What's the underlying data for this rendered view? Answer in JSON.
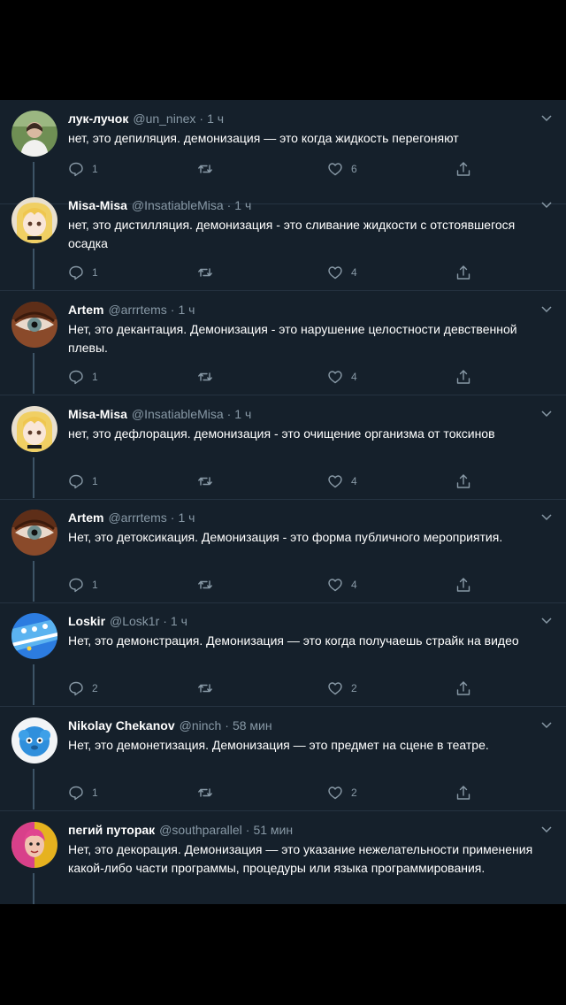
{
  "tweets": [
    {
      "name": "лук-лучок",
      "handle": "@un_ninex",
      "time": "1 ч",
      "text": "нет, это депиляция. демонизация — это когда жидкость перегоняют",
      "replies": "1",
      "retweets": "",
      "likes": "6",
      "avatar": "avatar-photo-woman"
    },
    {
      "name": "Misa-Misa",
      "handle": "@InsatiableMisa",
      "time": "1 ч",
      "text": "нет, это дистилляция. демонизация - это сливание жидкости с отстоявшегося осадка",
      "replies": "1",
      "retweets": "",
      "likes": "4",
      "avatar": "avatar-anime-blonde"
    },
    {
      "name": "Artem",
      "handle": "@arrrtems",
      "time": "1 ч",
      "text": "Нет, это декантация. Демонизация - это нарушение целостности девственной плевы.",
      "replies": "1",
      "retweets": "",
      "likes": "4",
      "avatar": "avatar-eye-closeup"
    },
    {
      "name": "Misa-Misa",
      "handle": "@InsatiableMisa",
      "time": "1 ч",
      "text": "нет, это дефлорация. демонизация - это очищение организма от токсинов",
      "replies": "1",
      "retweets": "",
      "likes": "4",
      "avatar": "avatar-anime-blonde"
    },
    {
      "name": "Artem",
      "handle": "@arrrtems",
      "time": "1 ч",
      "text": "Нет, это детоксикация. Демонизация - это форма публичного мероприятия.",
      "replies": "1",
      "retweets": "",
      "likes": "4",
      "avatar": "avatar-eye-closeup"
    },
    {
      "name": "Loskir",
      "handle": "@Losk1r",
      "time": "1 ч",
      "text": "Нет, это демонстрация. Демонизация — это когда получаешь страйк на видео",
      "replies": "2",
      "retweets": "",
      "likes": "2",
      "avatar": "avatar-blue-pattern"
    },
    {
      "name": "Nikolay Chekanov",
      "handle": "@ninch",
      "time": "58 мин",
      "text": "Нет, это демонетизация. Демонизация — это предмет на сцене в театре.",
      "replies": "1",
      "retweets": "",
      "likes": "2",
      "avatar": "avatar-blue-fluffy"
    },
    {
      "name": "пегий путорак",
      "handle": "@southparallel",
      "time": "51 мин",
      "text": "Нет, это декорация. Демонизация — это указание нежелательности применения какой-либо части программы, процедуры или языка программирования.",
      "replies": "",
      "retweets": "",
      "likes": "",
      "avatar": "avatar-pink-portrait"
    }
  ],
  "colors": {
    "background": "#15202b",
    "text_primary": "#ffffff",
    "text_secondary": "#8899a6",
    "thread_line": "#3d5466"
  },
  "icons": {
    "reply": "reply-icon",
    "retweet": "retweet-icon",
    "like": "like-icon",
    "share": "share-icon",
    "more": "chevron-down-icon"
  }
}
